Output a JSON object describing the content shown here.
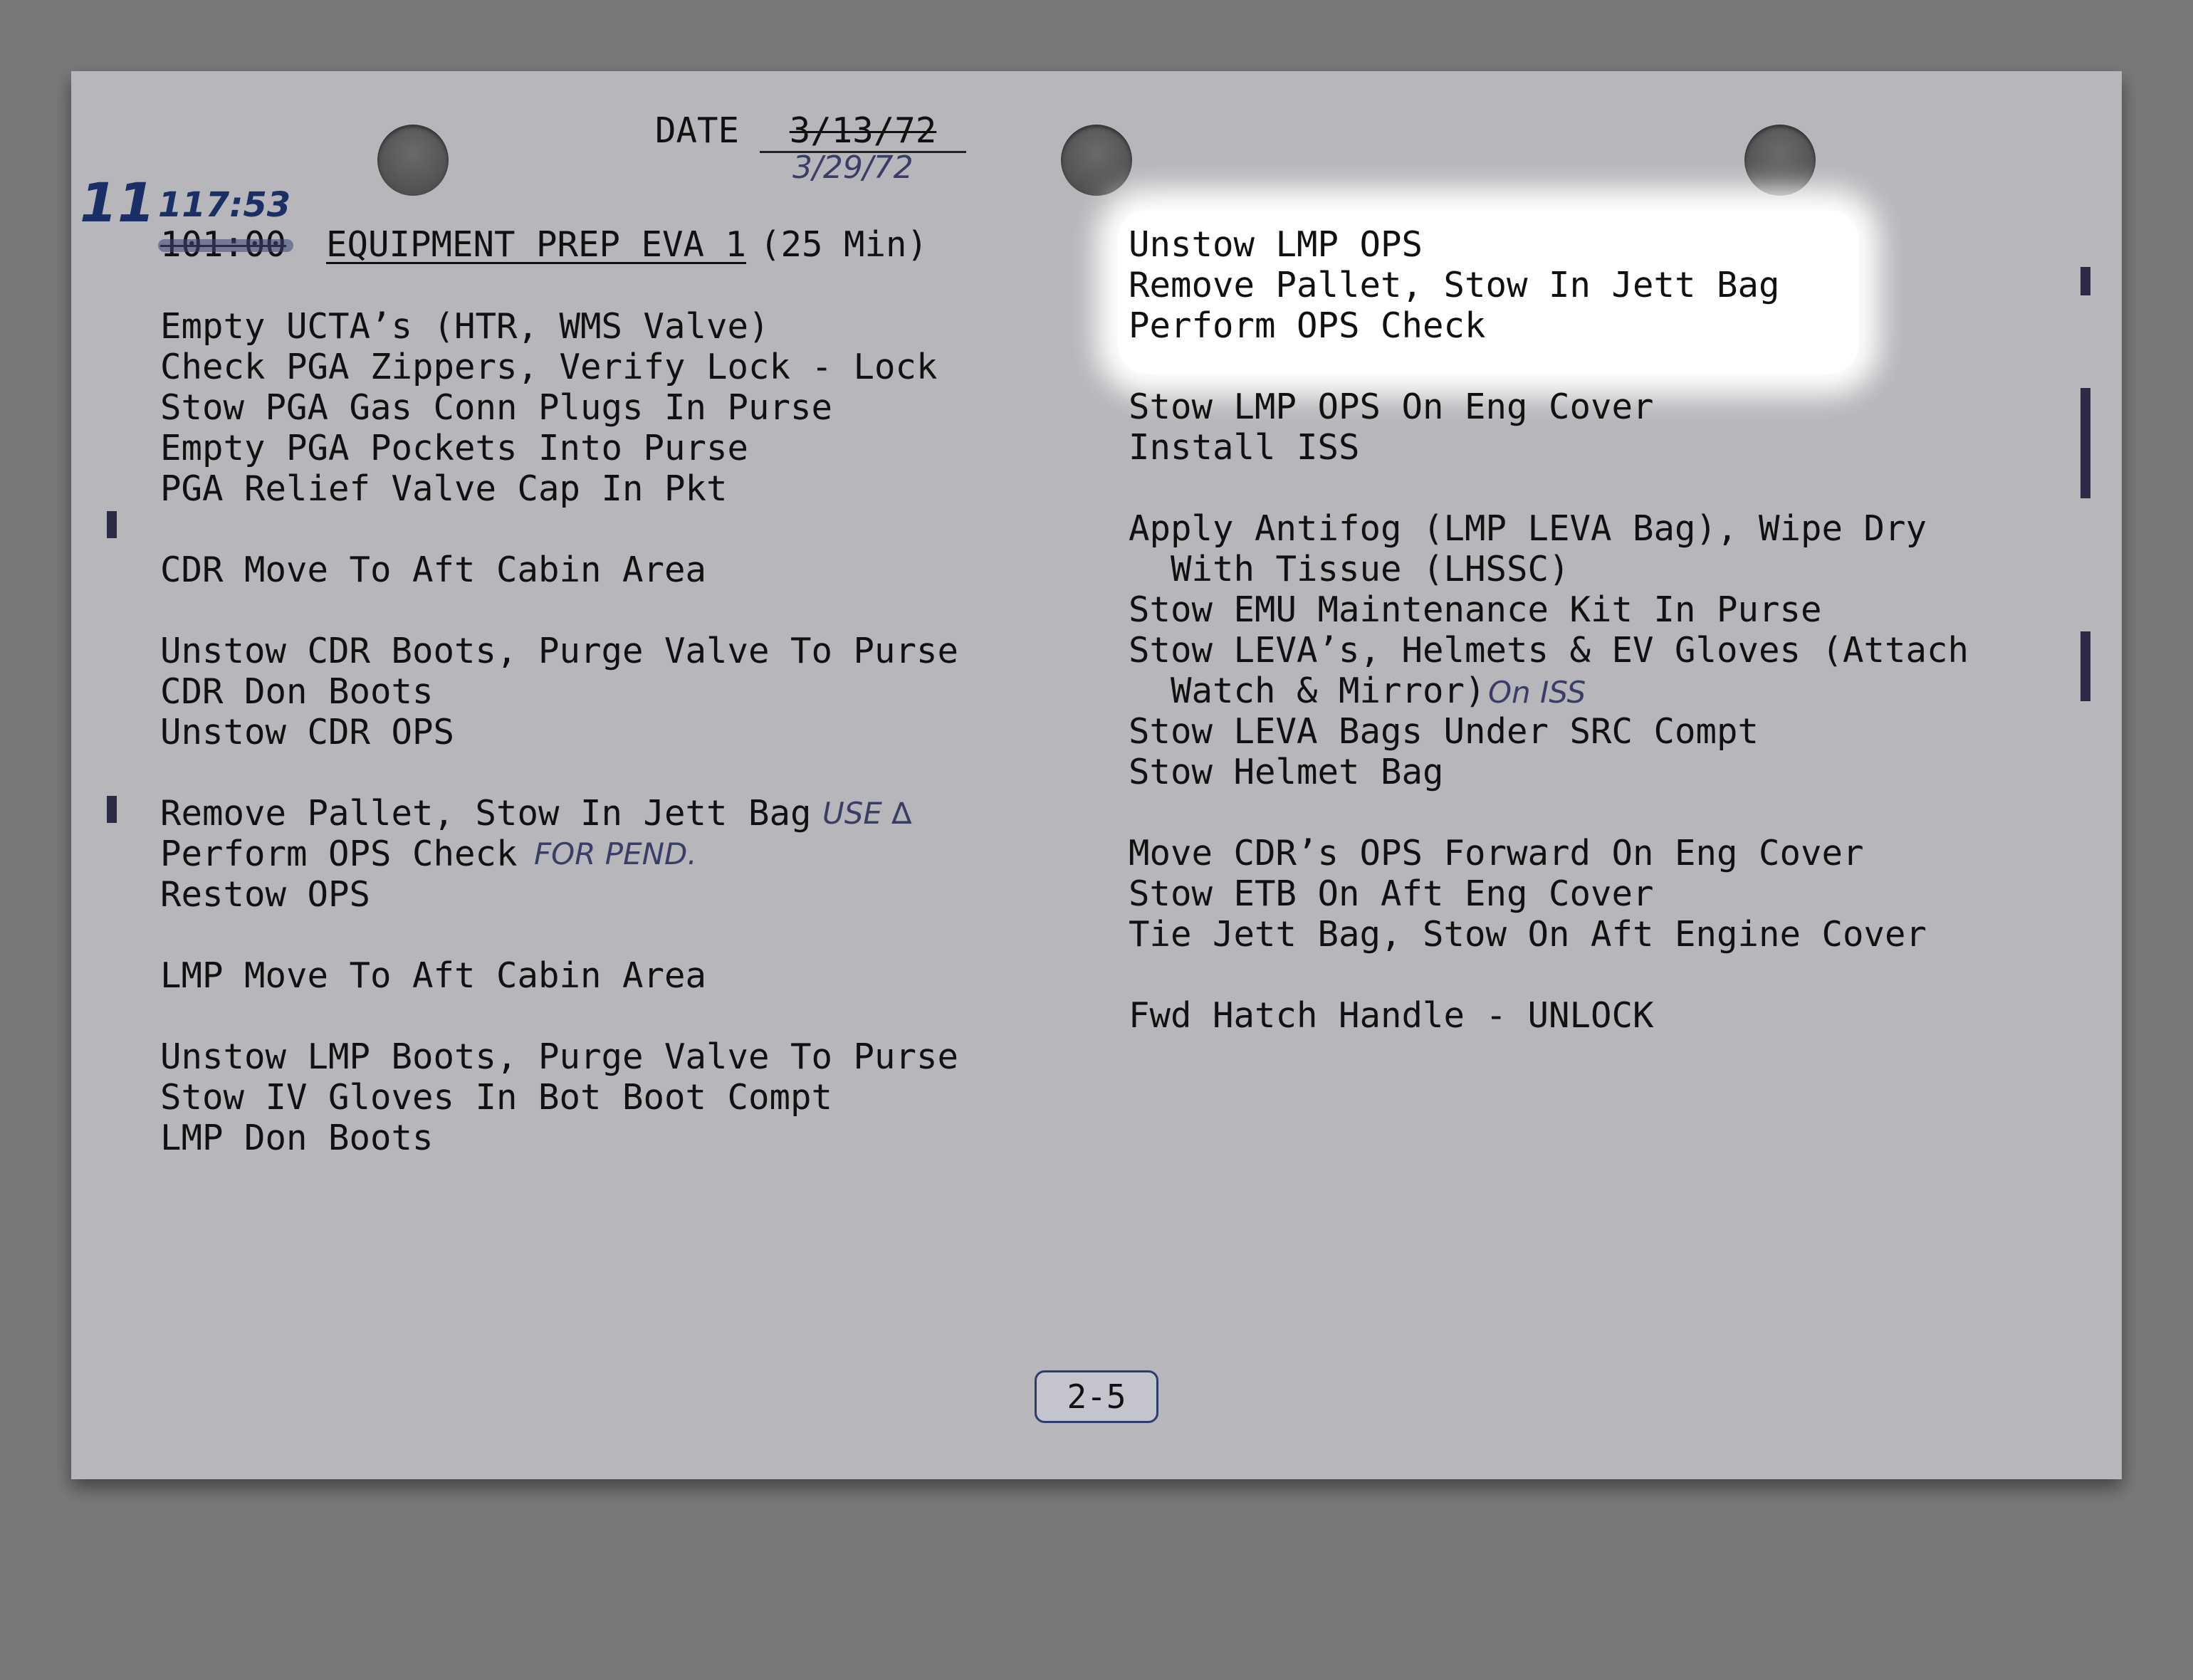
{
  "header": {
    "date_label": "DATE",
    "date_original": "3/13/72",
    "date_revised": "3/29/72"
  },
  "annotations": {
    "day_number": "11",
    "revised_time": "117:53"
  },
  "procedure": {
    "original_time": "101:00",
    "title": "EQUIPMENT PREP EVA 1",
    "duration": "(25 Min)"
  },
  "left_column": [
    "Empty UCTA’s (HTR, WMS Valve)",
    "Check PGA Zippers, Verify Lock - Lock",
    "Stow PGA Gas Conn Plugs In Purse",
    "Empty PGA Pockets Into Purse",
    "PGA Relief Valve Cap In Pkt",
    "CDR Move To Aft Cabin Area",
    "Unstow CDR Boots, Purge Valve To Purse",
    "CDR Don Boots",
    "Unstow CDR OPS",
    "Remove Pallet, Stow In Jett Bag",
    "Perform OPS Check",
    "Restow OPS",
    "LMP Move To Aft Cabin Area",
    "Unstow LMP Boots, Purge Valve To Purse",
    "Stow IV Gloves In Bot Boot Compt",
    "LMP Don Boots"
  ],
  "left_notes": {
    "use_delta": "USE ∆",
    "for_pend": "FOR PEND."
  },
  "right_column": [
    "Unstow LMP OPS",
    "Remove Pallet, Stow In Jett Bag",
    "Perform OPS Check",
    "Stow LMP OPS On Eng Cover",
    "Install ISS",
    "Apply Antifog (LMP LEVA Bag), Wipe Dry",
    "  With Tissue (LHSSC)",
    "Stow EMU Maintenance Kit In Purse",
    "Stow LEVA’s, Helmets & EV Gloves (Attach",
    "  Watch & Mirror)",
    "Stow LEVA Bags Under SRC Compt",
    "Stow Helmet Bag",
    "Move CDR’s OPS Forward On Eng Cover",
    "Stow ETB On Aft Eng Cover",
    "Tie Jett Bag, Stow On Aft Engine Cover",
    "Fwd Hatch Handle - UNLOCK"
  ],
  "right_notes": {
    "on_iss": "On ISS"
  },
  "footer": {
    "page_number": "2-5"
  }
}
